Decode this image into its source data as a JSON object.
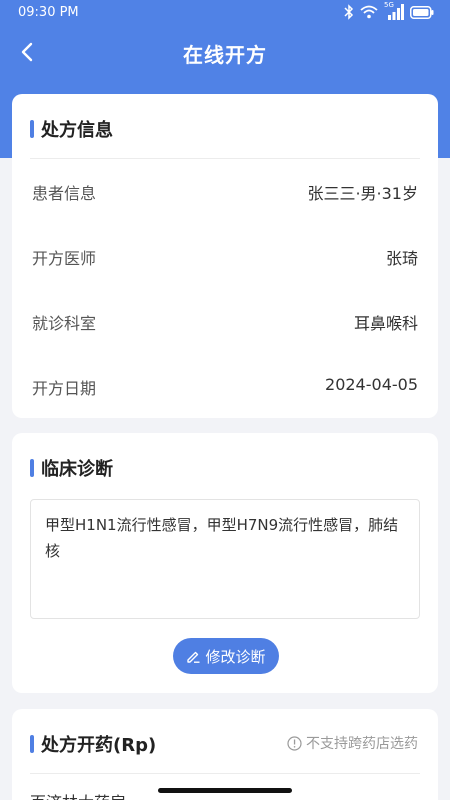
{
  "status_bar": {
    "time": "09:30 PM",
    "network": "5G"
  },
  "nav": {
    "title": "在线开方"
  },
  "prescription_info": {
    "title": "处方信息",
    "rows": [
      {
        "label": "患者信息",
        "value": "张三三·男·31岁"
      },
      {
        "label": "开方医师",
        "value": "张琦"
      },
      {
        "label": "就诊科室",
        "value": "耳鼻喉科"
      },
      {
        "label": "开方日期",
        "value": "2024-04-05"
      }
    ]
  },
  "diagnosis": {
    "title": "临床诊断",
    "text": "甲型H1N1流行性感冒，甲型H7N9流行性感冒，肺结核",
    "edit_label": "修改诊断"
  },
  "medication": {
    "title": "处方开药(Rp)",
    "notice": "不支持跨药店选药",
    "pharmacy": "百济林大药房"
  },
  "colors": {
    "primary": "#5082e6",
    "accent": "#4f7fe3"
  }
}
